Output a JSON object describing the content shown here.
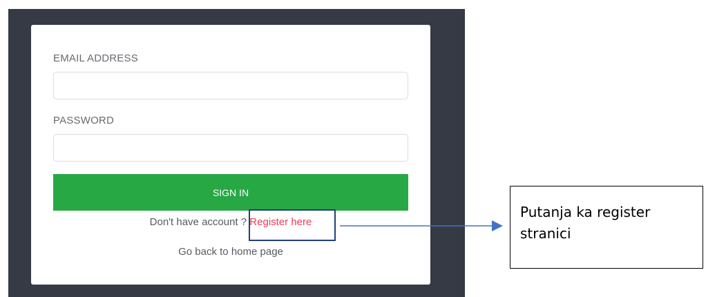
{
  "form": {
    "email_label": "EMAIL ADDRESS",
    "email_value": "",
    "password_label": "PASSWORD",
    "password_value": "",
    "signin_label": "SIGN IN",
    "no_account_text": "Don't have account ?",
    "register_link": "Register here",
    "home_link": "Go back to home page"
  },
  "annotation": {
    "text": "Putanja ka register stranici"
  },
  "colors": {
    "background_dark": "#353a45",
    "signin_green": "#28a745",
    "register_red": "#ef3b54",
    "annotation_blue": "#4472c4",
    "highlight_box": "#1f3f7a"
  }
}
